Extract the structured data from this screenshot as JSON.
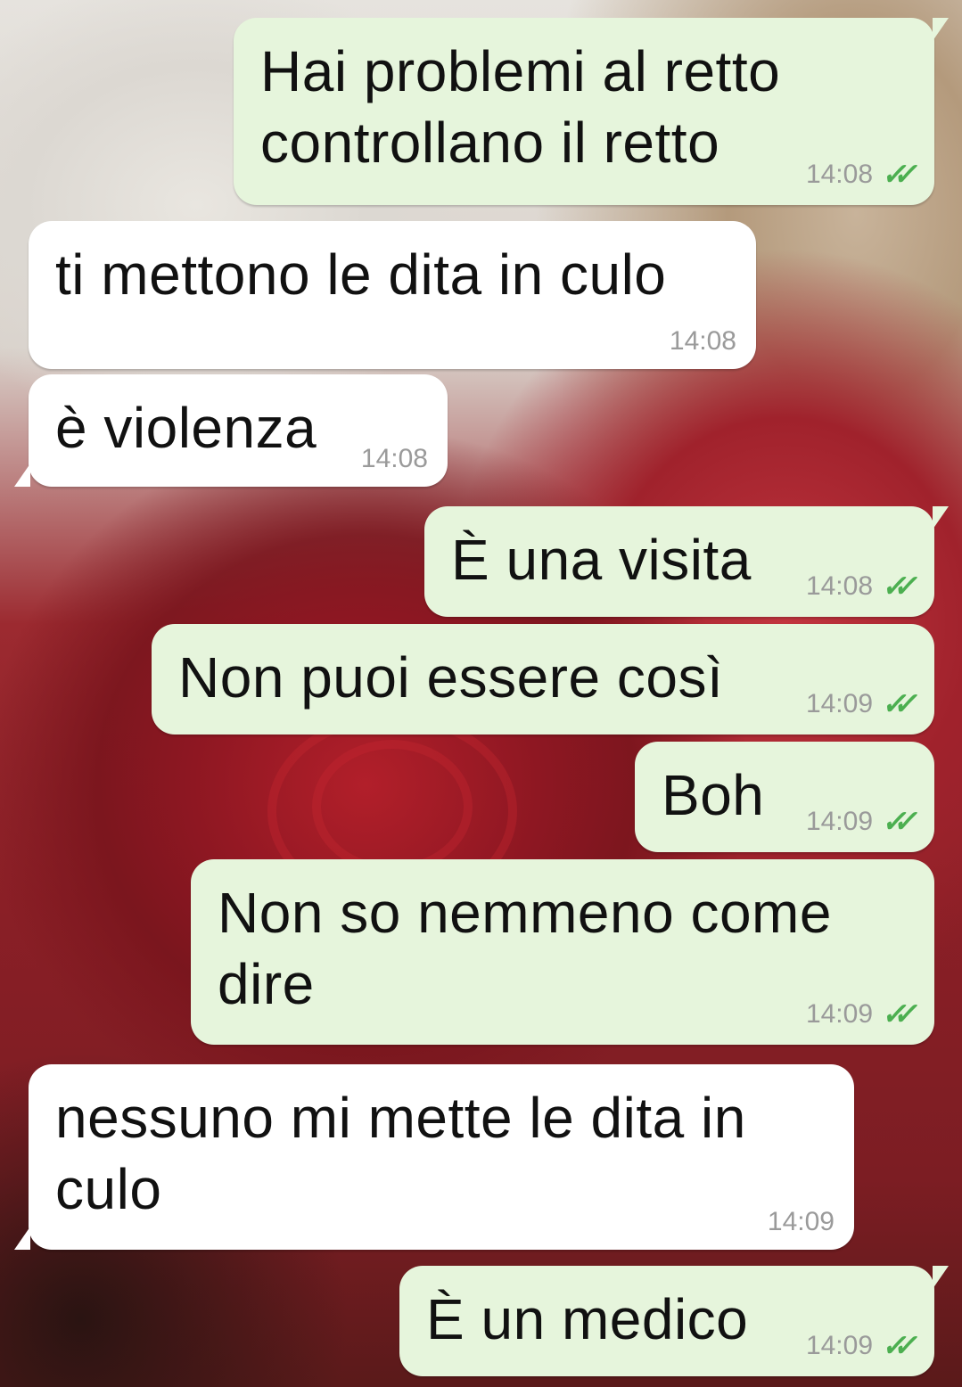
{
  "messages": [
    {
      "direction": "out",
      "text": "Hai problemi al retto\ncontrollano il retto",
      "time": "14:08",
      "status": "read"
    },
    {
      "direction": "in",
      "text": "ti mettono le dita in culo",
      "time": "14:08"
    },
    {
      "direction": "in",
      "text": "è violenza",
      "time": "14:08"
    },
    {
      "direction": "out",
      "text": "È una visita",
      "time": "14:08",
      "status": "read"
    },
    {
      "direction": "out",
      "text": "Non puoi essere così",
      "time": "14:09",
      "status": "read"
    },
    {
      "direction": "out",
      "text": "Boh",
      "time": "14:09",
      "status": "read"
    },
    {
      "direction": "out",
      "text": "Non so nemmeno come\ndire",
      "time": "14:09",
      "status": "read"
    },
    {
      "direction": "in",
      "text": "nessuno mi mette le dita in\nculo",
      "time": "14:09"
    },
    {
      "direction": "out",
      "text": "È un medico",
      "time": "14:09",
      "status": "read"
    }
  ],
  "icons": {
    "read_status": "double-check-icon"
  },
  "colors": {
    "outgoing_bubble": "#e6f5dc",
    "incoming_bubble": "#ffffff",
    "read_ticks": "#4caf50",
    "timestamp": "#9a9a9a"
  }
}
